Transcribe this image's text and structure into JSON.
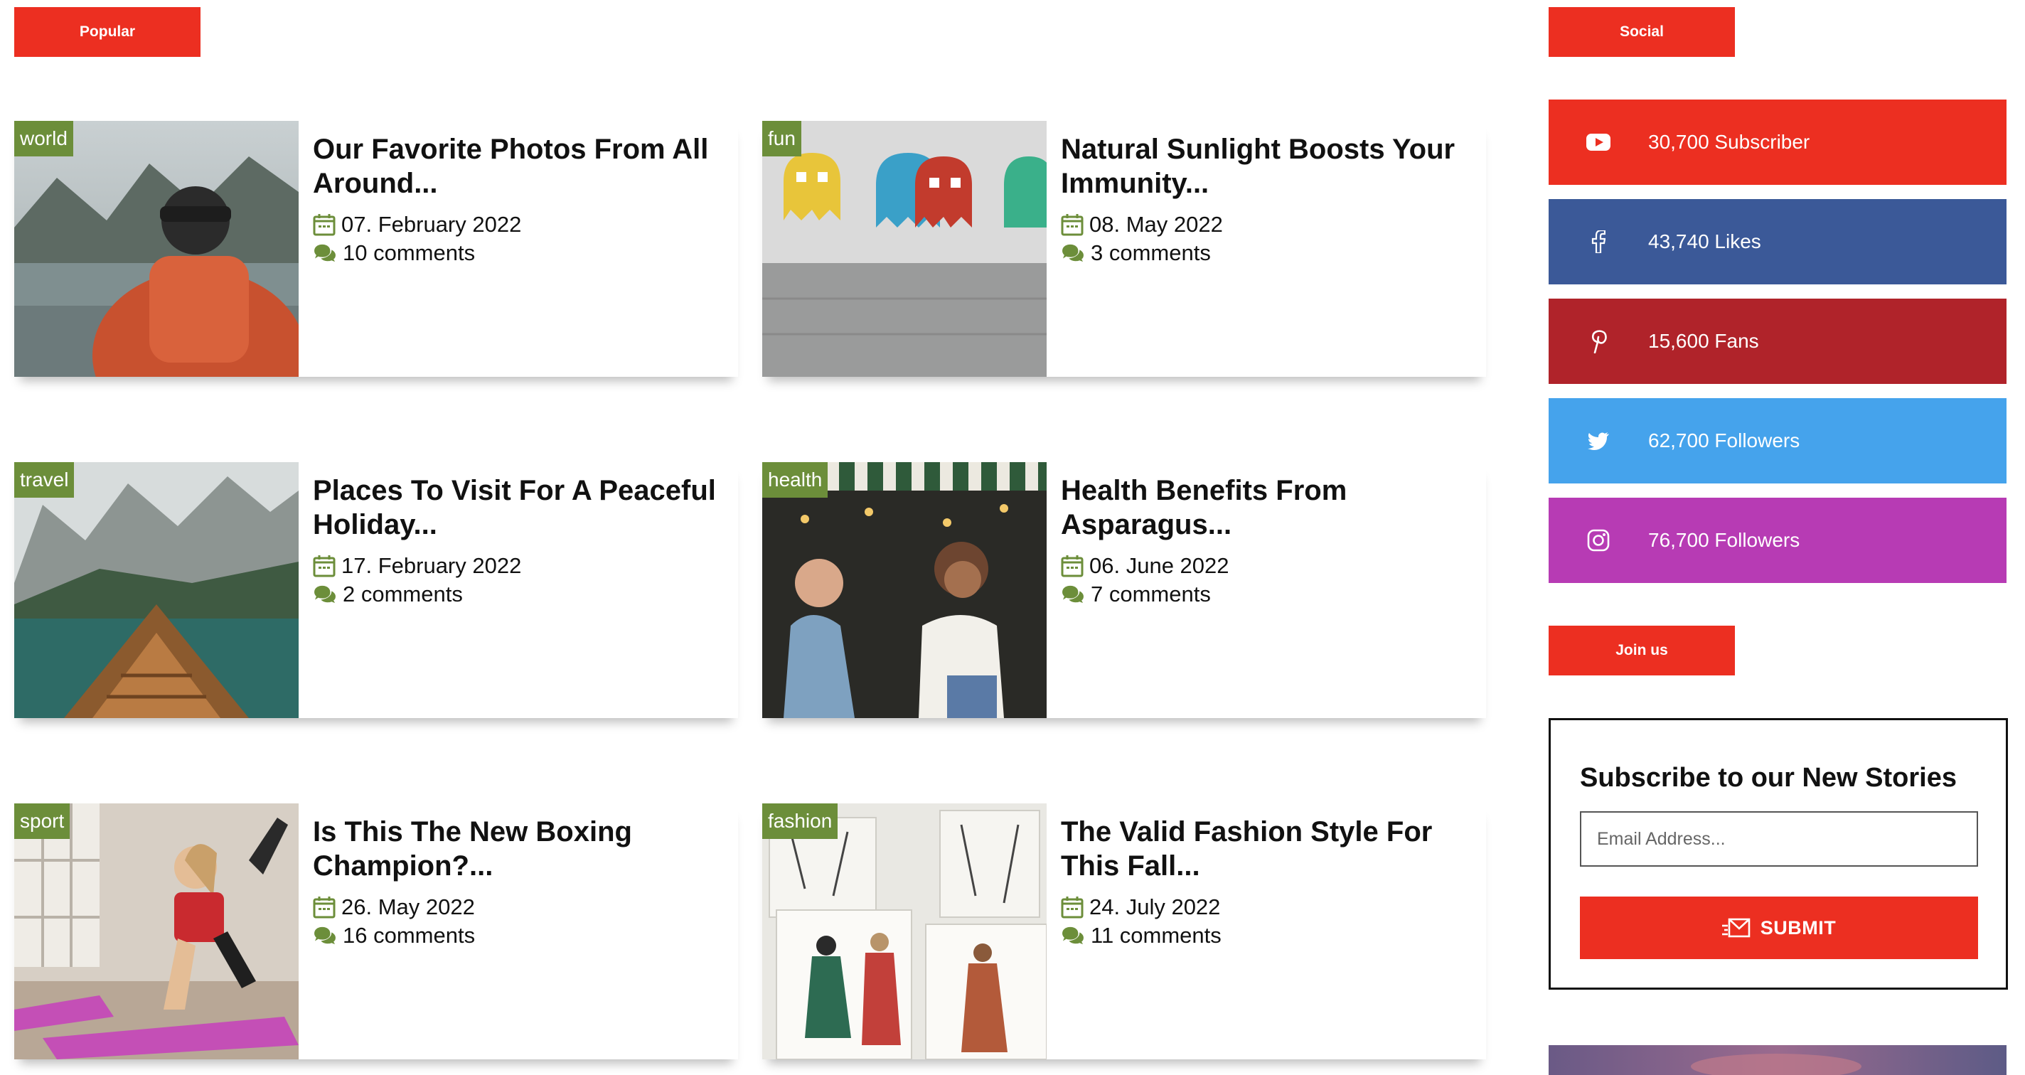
{
  "popular_label": "Popular",
  "social_label": "Social",
  "join_label": "Join us",
  "posts": [
    {
      "category": "world",
      "title": "Our Favorite Photos From All Around...",
      "date": "07. February 2022",
      "comments": "10 comments"
    },
    {
      "category": "fun",
      "title": "Natural Sunlight Boosts Your Immunity...",
      "date": "08. May 2022",
      "comments": "3 comments"
    },
    {
      "category": "travel",
      "title": "Places To Visit For A Peaceful Holiday...",
      "date": "17. February 2022",
      "comments": "2 comments"
    },
    {
      "category": "health",
      "title": "Health Benefits From Asparagus...",
      "date": "06. June 2022",
      "comments": "7 comments"
    },
    {
      "category": "sport",
      "title": "Is This The New Boxing Champion?...",
      "date": "26. May 2022",
      "comments": "16 comments"
    },
    {
      "category": "fashion",
      "title": "The Valid Fashion Style For This Fall...",
      "date": "24. July 2022",
      "comments": "11 comments"
    }
  ],
  "social": [
    {
      "network": "youtube",
      "icon": "youtube-icon",
      "text": "30,700 Subscriber",
      "color": "#ec2f21"
    },
    {
      "network": "facebook",
      "icon": "facebook-icon",
      "text": "43,740 Likes",
      "color": "#3b5998"
    },
    {
      "network": "pinterest",
      "icon": "pinterest-icon",
      "text": "15,600 Fans",
      "color": "#b0232a"
    },
    {
      "network": "twitter",
      "icon": "twitter-icon",
      "text": "62,700 Followers",
      "color": "#45a3ec"
    },
    {
      "network": "instagram",
      "icon": "instagram-icon",
      "text": "76,700 Followers",
      "color": "#b73bb4"
    }
  ],
  "subscribe": {
    "title": "Subscribe to our New Stories",
    "placeholder": "Email Address...",
    "button": "SUBMIT"
  },
  "colors": {
    "accent": "#ec2f21",
    "category": "#6c8e3a",
    "icon_green": "#6c8e3a"
  }
}
